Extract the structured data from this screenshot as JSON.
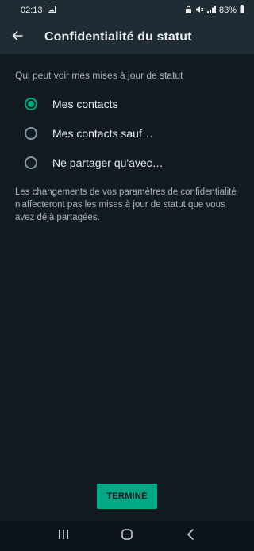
{
  "status_bar": {
    "time": "02:13",
    "battery": "83%",
    "icons": [
      "image-icon",
      "lock-icon",
      "mute-icon",
      "signal-icon",
      "battery-icon"
    ]
  },
  "app_bar": {
    "title": "Confidentialité du statut",
    "back_icon": "arrow-left-icon"
  },
  "section": {
    "header": "Qui peut voir mes mises à jour de statut",
    "options": [
      {
        "label": "Mes contacts",
        "selected": true
      },
      {
        "label": "Mes contacts sauf…",
        "selected": false
      },
      {
        "label": "Ne partager qu'avec…",
        "selected": false
      }
    ]
  },
  "info_text": "Les changements de vos paramètres de confidentialité n'affecteront pas les mises à jour de statut que vous avez déjà partagées.",
  "done_button": {
    "label": "TERMINÉ"
  },
  "nav_bar": {
    "icons": [
      "recent-apps-icon",
      "home-icon",
      "back-icon"
    ]
  },
  "colors": {
    "accent": "#00a884",
    "background": "#121b22",
    "app_bar": "#1f2c34",
    "text_primary": "#e9edef",
    "text_secondary": "#a7b3b9"
  }
}
